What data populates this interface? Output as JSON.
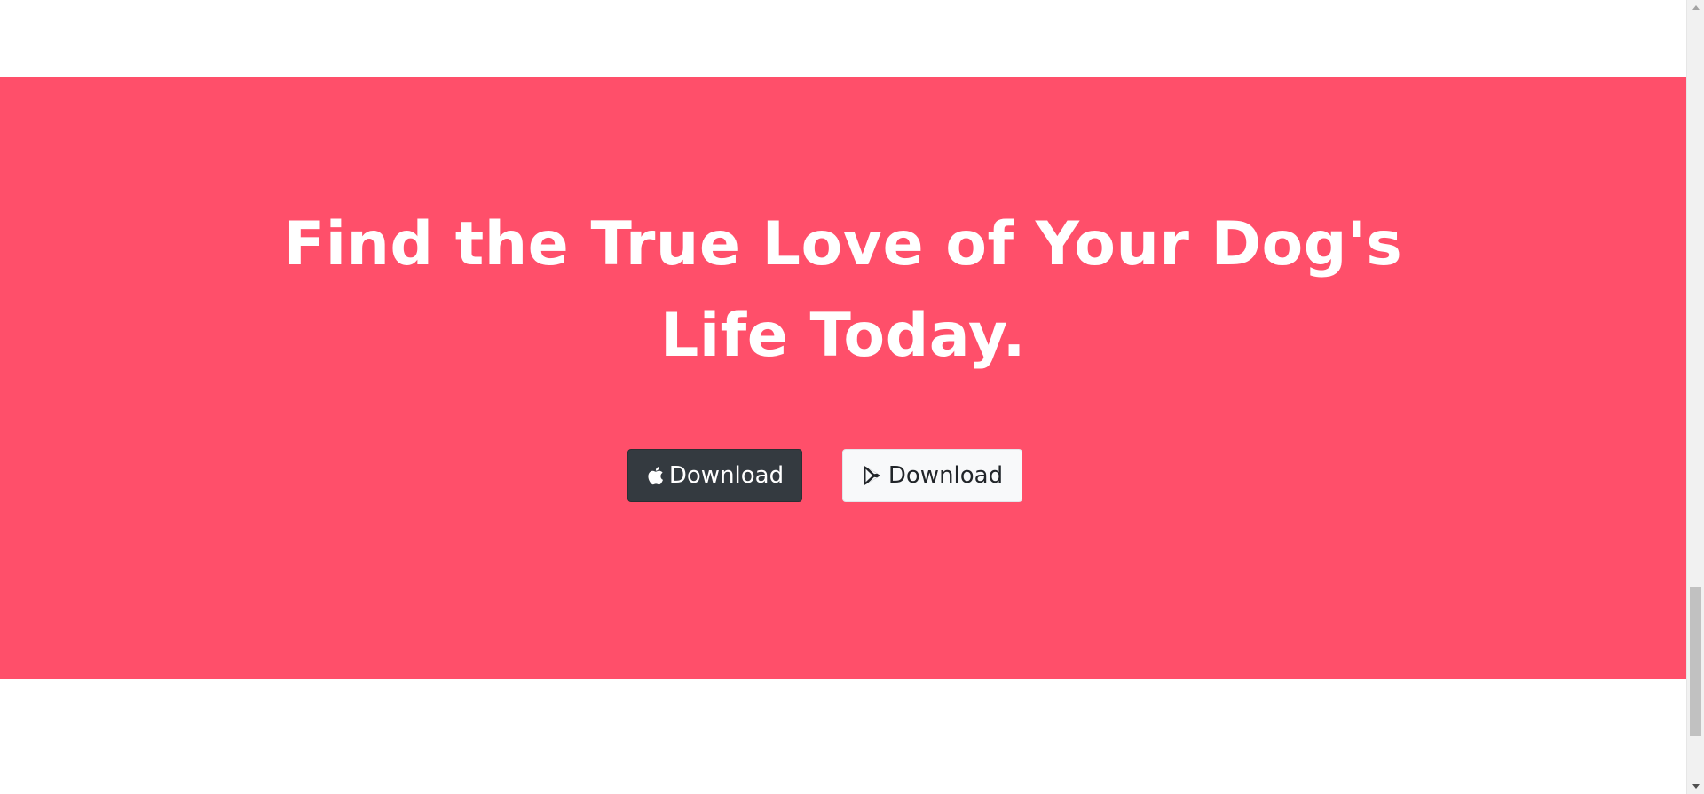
{
  "cta": {
    "headline": "Find the True Love of Your Dog's Life Today.",
    "background_color": "#ff4f6a",
    "buttons": [
      {
        "label": "Download",
        "icon": "apple-icon",
        "style": "dark"
      },
      {
        "label": "Download",
        "icon": "google-play-icon",
        "style": "light"
      }
    ]
  }
}
